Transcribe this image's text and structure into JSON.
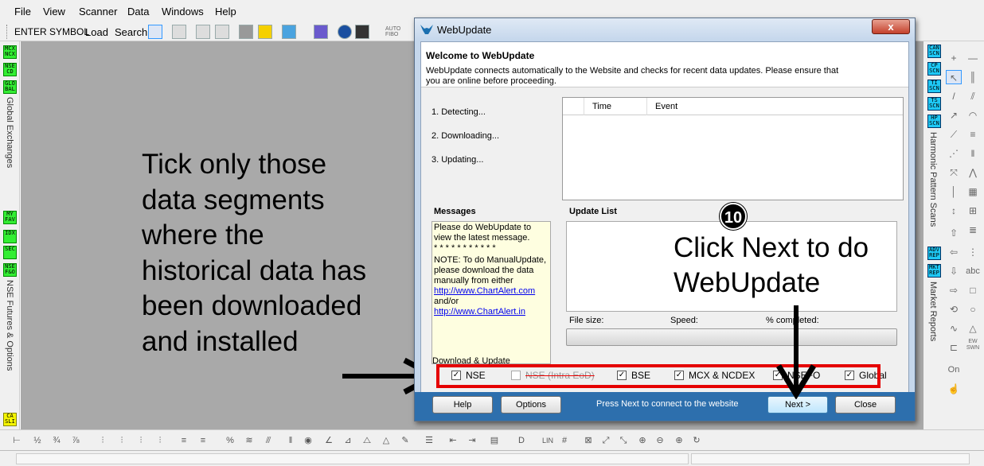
{
  "menu": [
    "File",
    "View",
    "Scanner",
    "Data",
    "Windows",
    "Help"
  ],
  "toolbar": {
    "symbol_label": "ENTER SYMBOL",
    "load_label": "Load",
    "search_label": "Search",
    "auto_fibo_label": "AUTO FIBO"
  },
  "left_panel": {
    "buttons_top": [
      "MCX NCX",
      "NSE CD",
      "GLO BAL"
    ],
    "section1_label": "Global Exchanges",
    "buttons_mid": [
      "MY FAV",
      "IDX",
      "SEC",
      "NSE F&O"
    ],
    "section2_label": "NSE Futures & Options",
    "button_bottom": "CA SLI"
  },
  "right_panel": {
    "buttons_top": [
      "CAN SCN",
      "CP SCN",
      "TI SCN",
      "TS SCN",
      "HP SCN"
    ],
    "section1_label": "Harmonic Pattern Scans",
    "buttons_bottom": [
      "ADV REP",
      "MKT REP"
    ],
    "section2_label": "Market Reports",
    "tools_text": [
      "abc",
      "EW SWN",
      "On"
    ]
  },
  "instruction_text": "Tick only those data segments where the historical data has been downloaded and installed",
  "dialog": {
    "title": "WebUpdate",
    "close_label": "x",
    "welcome_title": "Welcome to WebUpdate",
    "welcome_desc": "WebUpdate connects automatically to the Website and checks for recent data updates. Please ensure that you are online before proceeding.",
    "steps": [
      "1.  Detecting...",
      "2.  Downloading...",
      "3.  Updating..."
    ],
    "log_columns": [
      "Time",
      "Event"
    ],
    "messages_label": "Messages",
    "messages": {
      "line1": "Please do WebUpdate to view the latest message.",
      "dots": "* * * * * * * * * * *",
      "note": "NOTE: To do ManualUpdate, please download the data manually from either",
      "link1": "http://www.ChartAlert.com",
      "andor": "and/or",
      "link2": "http://www.ChartAlert.in"
    },
    "update_list_label": "Update List",
    "file_size_label": "File size:",
    "speed_label": "Speed:",
    "completed_label": "% completed:",
    "download_update_label": "Download & Update",
    "segments": [
      {
        "label": "NSE",
        "checked": true
      },
      {
        "label": "NSE (Intra EoD)",
        "checked": false
      },
      {
        "label": "BSE",
        "checked": true
      },
      {
        "label": "MCX & NCDEX",
        "checked": true
      },
      {
        "label": "NSEFO",
        "checked": true
      },
      {
        "label": "Global",
        "checked": true
      }
    ],
    "buttons": {
      "help": "Help",
      "options": "Options",
      "next": "Next >",
      "close": "Close"
    },
    "footer_status": "Press Next to connect to the website"
  },
  "annotation": {
    "step_number": "10",
    "caption": "Click Next to do WebUpdate"
  },
  "colors": {
    "highlight_red": "#e50000",
    "footer_blue": "#2d6fad",
    "green_btn": "#33ee33",
    "blue_btn": "#1ec8f5"
  }
}
